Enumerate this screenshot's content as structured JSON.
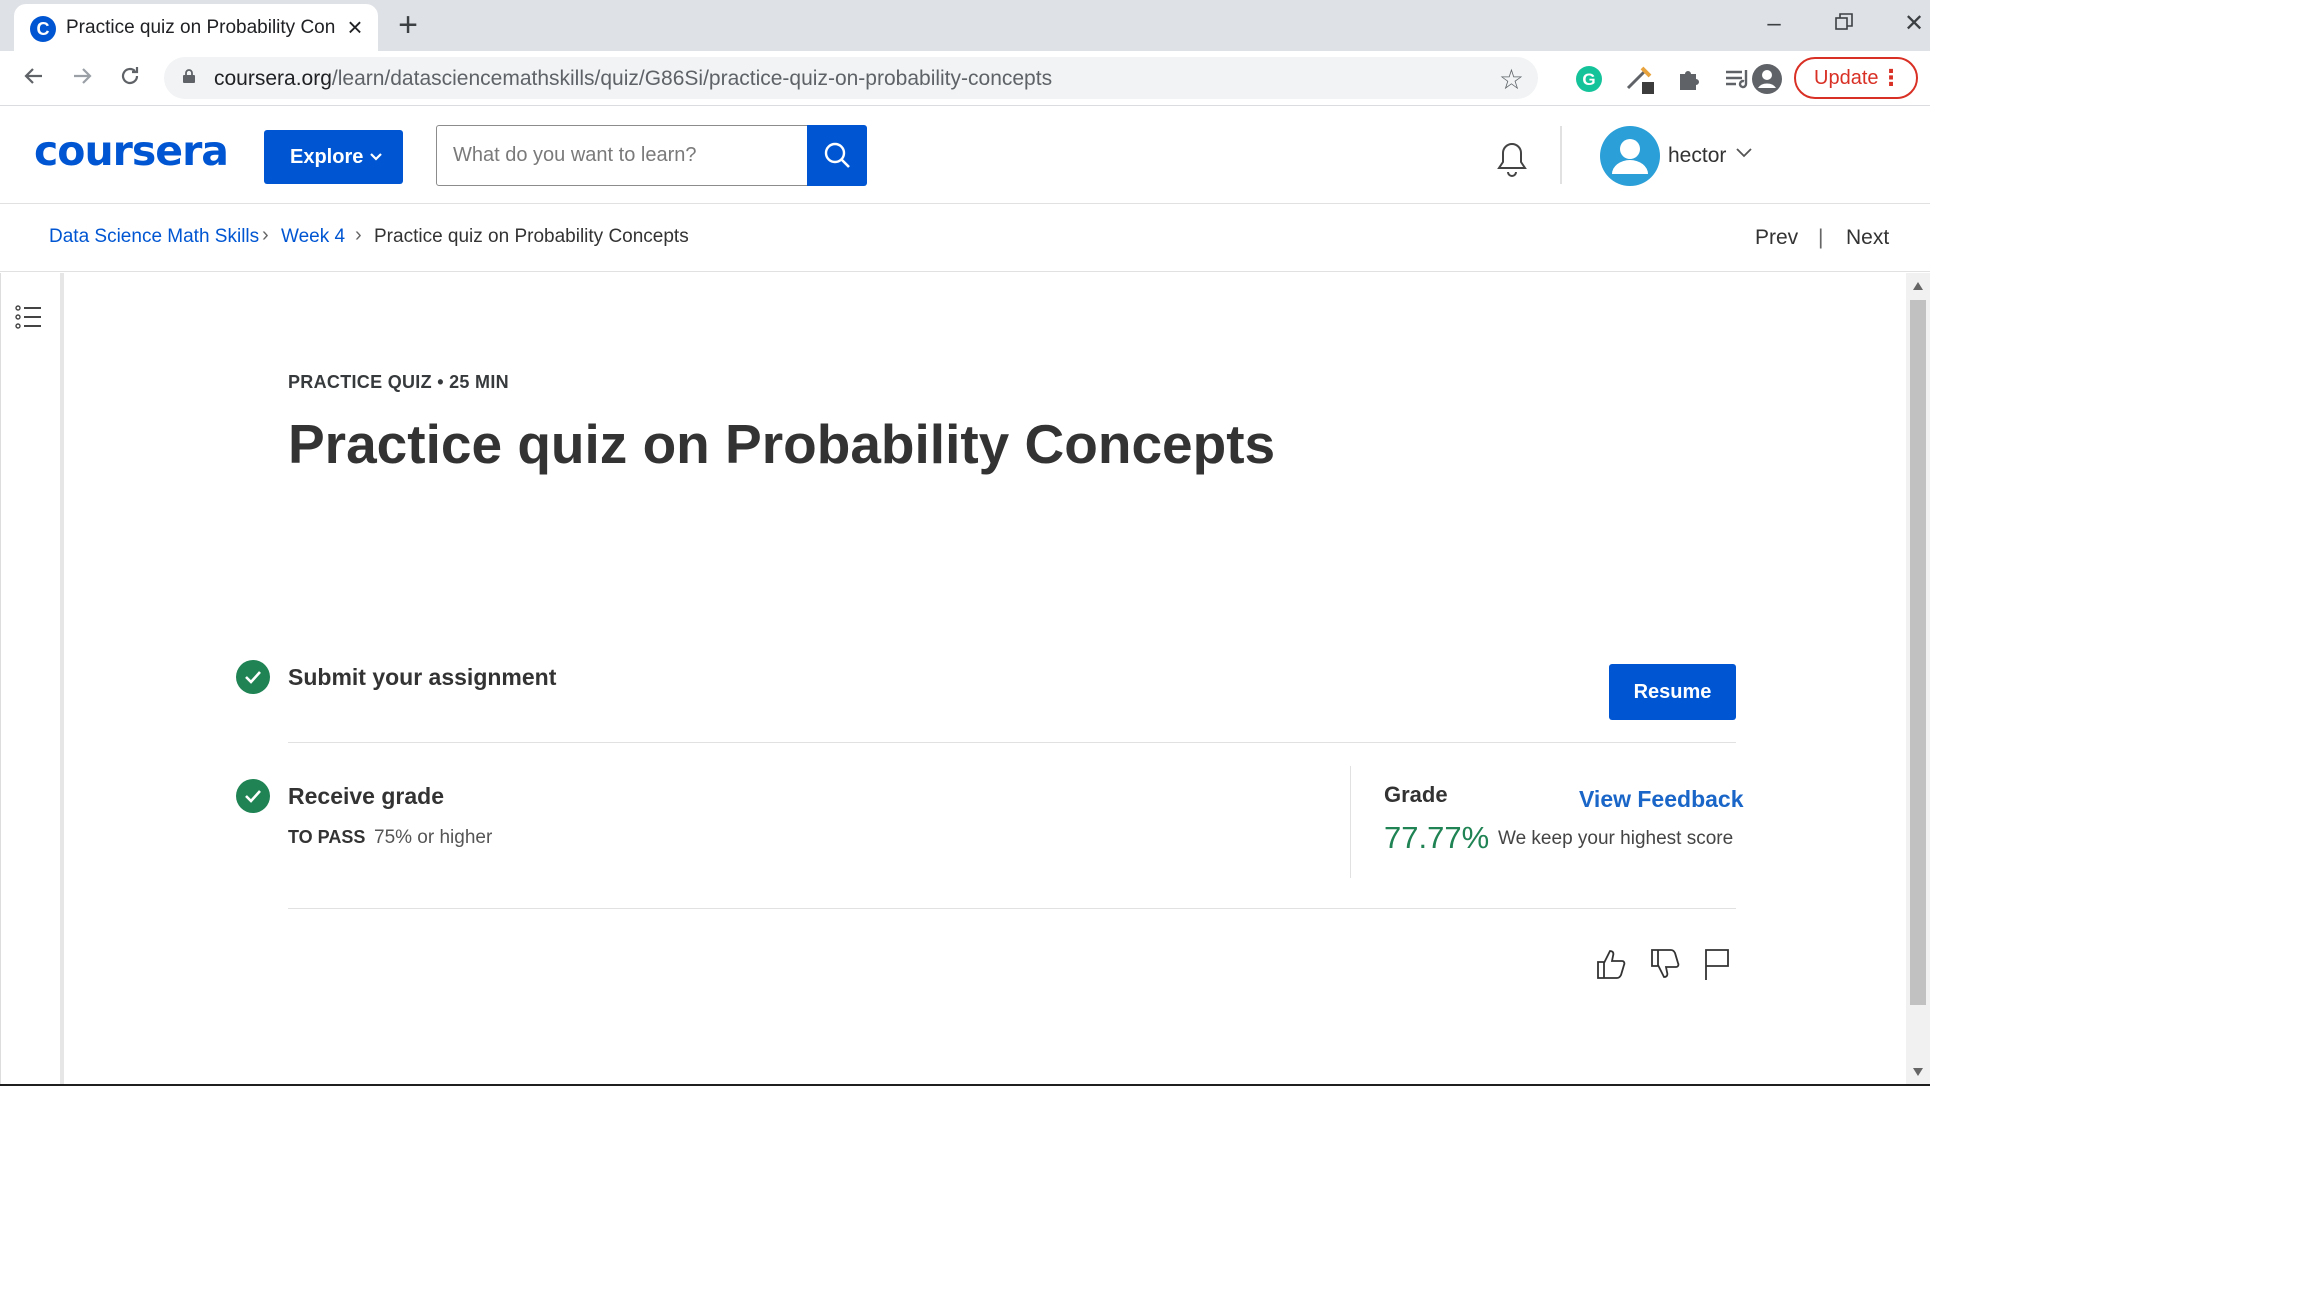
{
  "browser": {
    "tab_title": "Practice quiz on Probability Concepts",
    "url_host": "coursera.org",
    "url_path": "/learn/datasciencemathskills/quiz/G86Si/practice-quiz-on-probability-concepts",
    "update_label": "Update"
  },
  "header": {
    "logo": "coursera",
    "explore_label": "Explore",
    "search_placeholder": "What do you want to learn?",
    "username": "hector"
  },
  "breadcrumb": {
    "items": [
      "Data Science Math Skills",
      "Week 4",
      "Practice quiz on Probability Concepts"
    ],
    "prev": "Prev",
    "separator": "|",
    "next": "Next"
  },
  "quiz": {
    "kicker": "PRACTICE QUIZ • 25 MIN",
    "title": "Practice quiz on Probability Concepts",
    "submit_step": "Submit your assignment",
    "resume_label": "Resume",
    "receive_step": "Receive grade",
    "to_pass_label": "TO PASS",
    "to_pass_value": "75% or higher",
    "grade_label": "Grade",
    "view_feedback": "View Feedback",
    "grade_value": "77.77%",
    "grade_note": "We keep your highest score"
  },
  "colors": {
    "brand": "#0056d2",
    "success": "#1f8354",
    "update": "#d93025"
  }
}
